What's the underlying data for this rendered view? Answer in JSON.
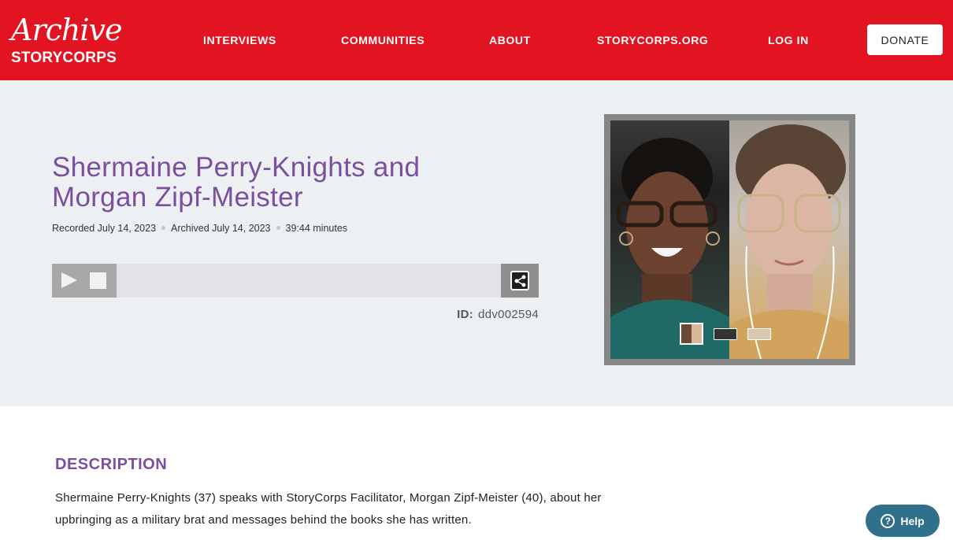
{
  "logo": {
    "script": "Archive",
    "word": "STORYCORPS"
  },
  "nav": {
    "items": [
      {
        "label": "INTERVIEWS"
      },
      {
        "label": "COMMUNITIES"
      },
      {
        "label": "ABOUT"
      },
      {
        "label": "STORYCORPS.ORG"
      },
      {
        "label": "LOG IN"
      }
    ],
    "donate": "DONATE"
  },
  "interview": {
    "title_line1": "Shermaine Perry-Knights and",
    "title_line2": "Morgan Zipf-Meister",
    "recorded": "Recorded July 14, 2023",
    "archived": "Archived July 14, 2023",
    "duration": "39:44 minutes",
    "id_label": "ID:",
    "id_value": "ddv002594"
  },
  "player": {
    "play_icon": "play-icon",
    "stop_icon": "stop-icon",
    "share_icon": "share-icon",
    "progress": 0
  },
  "description": {
    "heading": "DESCRIPTION",
    "line1": "Shermaine Perry-Knights (37) speaks with StoryCorps Facilitator, Morgan Zipf-Meister (40), about her",
    "line2": "upbringing as a military brat and messages behind the books she has written."
  },
  "help": {
    "label": "Help",
    "icon": "question-circle-icon"
  },
  "colors": {
    "brand_red": "#e31422",
    "title_purple": "#7b4f9d",
    "hero_bg": "#edf0f2",
    "help_teal": "#30708c"
  }
}
